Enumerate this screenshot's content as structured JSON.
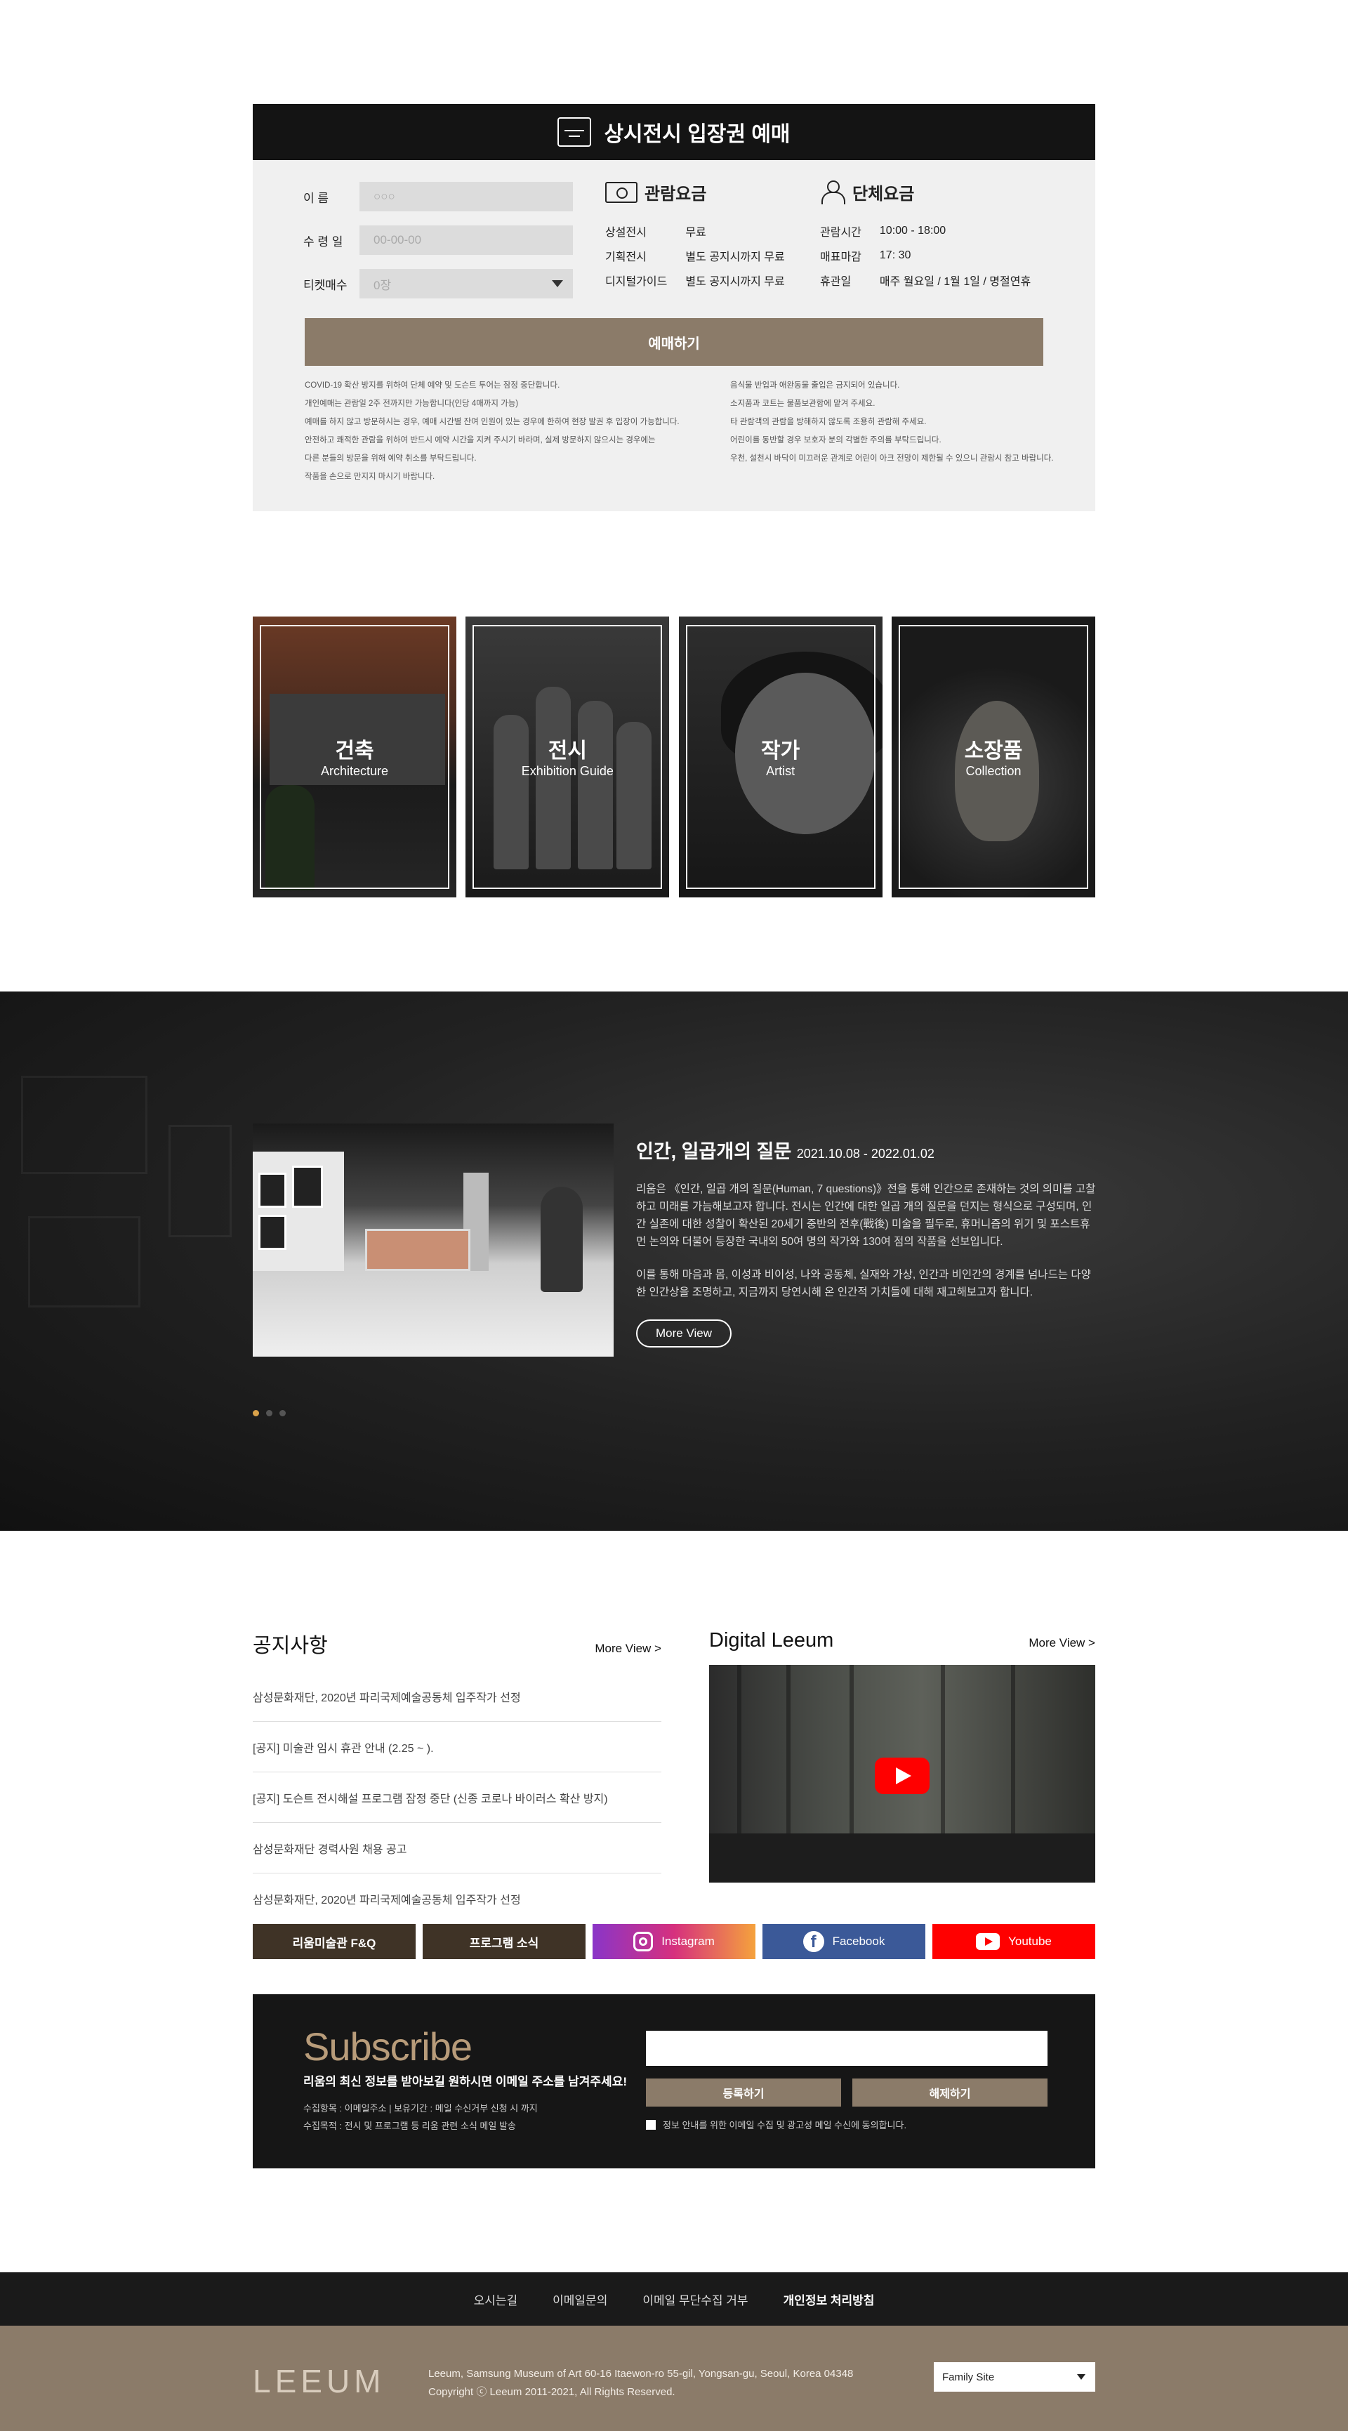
{
  "ticket": {
    "title": "상시전시 입장권 예매",
    "form": {
      "name_label": "이    름",
      "name_placeholder": "○○○",
      "date_label": "수 령 일",
      "date_placeholder": "00-00-00",
      "count_label": "티켓매수",
      "count_value": "0장"
    },
    "fees": {
      "title": "관람요금",
      "rows": [
        [
          "상설전시",
          "무료"
        ],
        [
          "기획전시",
          "별도 공지시까지 무료"
        ],
        [
          "디지털가이드",
          "별도 공지시까지 무료"
        ]
      ]
    },
    "group": {
      "title": "단체요금",
      "rows": [
        [
          "관람시간",
          "10:00 - 18:00"
        ],
        [
          "매표마감",
          "17: 30"
        ],
        [
          "휴관일",
          "매주 월요일 / 1월 1일 / 명절연휴"
        ]
      ]
    },
    "book_label": "예매하기",
    "notes_left": [
      "COVID-19 확산 방지를 위하여 단체 예약 및 도슨트 투어는 잠정 중단합니다.",
      "개인예매는 관람일 2주 전까지만 가능합니다(인당 4매까지 가능)",
      "예매를 하지 않고 방문하시는 경우, 예매 시간별 잔여 인원이 있는 경우에 한하여 현장 발권 후 입장이 가능합니다.",
      "안전하고 쾌적한 관람을 위하여 반드시 예약 시간을 지켜 주시기 바라며, 실제 방문하지 않으시는 경우에는",
      "다른 분들의 방문을 위해 예약 취소를 부탁드립니다.",
      "작품을 손으로 만지지 마시기 바랍니다."
    ],
    "notes_right": [
      "음식물 반입과 애완동물 출입은 금지되어 있습니다.",
      "소지품과 코트는 물품보관함에 맡겨 주세요.",
      "타 관람객의 관람을 방해하지 않도록 조용히 관람해 주세요.",
      "어린이를 동반할 경우 보호자 분의 각별한 주의를 부탁드립니다.",
      "우천, 설천시 바닥이 미끄러운 관계로 어린이 아크 전망이 제한될 수 있으니 관람시 참고 바랍니다."
    ]
  },
  "categories": [
    {
      "ko": "건축",
      "en": "Architecture"
    },
    {
      "ko": "전시",
      "en": "Exhibition Guide"
    },
    {
      "ko": "작가",
      "en": "Artist"
    },
    {
      "ko": "소장품",
      "en": "Collection"
    }
  ],
  "exhibition": {
    "title": "인간, 일곱개의 질문",
    "dates": "2021.10.08 - 2022.01.02",
    "para1": "리움은 《인간, 일곱 개의 질문(Human, 7 questions)》전을 통해 인간으로 존재하는 것의 의미를 고찰하고 미래를 가늠해보고자 합니다. 전시는 인간에 대한 일곱 개의 질문을 던지는 형식으로 구성되며, 인간 실존에 대한 성찰이 확산된 20세기 중반의 전후(戰後) 미술을 필두로, 휴머니즘의 위기 및 포스트휴먼 논의와 더불어 등장한 국내외 50여 명의 작가와 130여 점의 작품을 선보입니다.",
    "para2": "이를 통해 마음과 몸, 이성과 비이성, 나와 공동체, 실재와 가상, 인간과 비인간의 경계를 넘나드는 다양한 인간상을 조명하고, 지금까지 당연시해 온 인간적 가치들에 대해 재고해보고자 합니다.",
    "more_label": "More View",
    "active_slide": 1,
    "slide_count": 3
  },
  "notice": {
    "title": "공지사항",
    "more_label": "More View >",
    "items": [
      "삼성문화재단, 2020년 파리국제예술공동체 입주작가 선정",
      "[공지] 미술관 임시 휴관 안내 (2.25 ~ ).",
      "[공지] 도슨트 전시해설 프로그램 잠정 중단 (신종 코로나 바이러스 확산 방지)",
      "삼성문화재단 경력사원 채용 공고",
      "삼성문화재단, 2020년 파리국제예술공동체 입주작가 선정"
    ]
  },
  "digital": {
    "title": "Digital Leeum",
    "more_label": "More View >"
  },
  "links": {
    "faq": "리움미술관 F&Q",
    "program": "프로그램 소식",
    "instagram": "Instagram",
    "facebook": "Facebook",
    "youtube": "Youtube"
  },
  "subscribe": {
    "title": "Subscribe",
    "lead": "리움의 최신 정보를 받아보길 원하시면 이메일 주소를 남겨주세요!",
    "info1": "수집항목 : 이메일주소  |  보유기간 : 메일 수신거부 신청 시 까지",
    "info2": "수집목적 : 전시 및 프로그램 등 리움 관련 소식 메일 발송",
    "register": "등록하기",
    "cancel": "해제하기",
    "agree": "정보 안내를 위한 이메일 수집 및 광고성 메일 수신에 동의합니다."
  },
  "footer": {
    "nav": [
      "오시는길",
      "이메일문의",
      "이메일 무단수집 거부",
      "개인정보 처리방침"
    ],
    "logo": "LEEUM",
    "address": "Leeum, Samsung Museum of Art 60-16 Itaewon-ro 55-gil, Yongsan-gu, Seoul, Korea 04348",
    "copyright": "Copyright ⓒ Leeum 2011-2021, All Rights Reserved.",
    "family_site": "Family Site"
  }
}
